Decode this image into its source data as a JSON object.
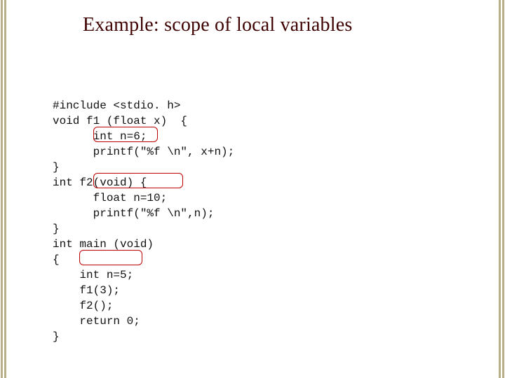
{
  "title": "Example: scope of local variables",
  "code": {
    "l01": "#include <stdio. h>",
    "l02": "void f1 (float x)  {",
    "l03": "      int n=6;",
    "l04": "      printf(\"%f \\n\", x+n);",
    "l05": "}",
    "l06": "int f2(void) {",
    "l07": "      float n=10;",
    "l08": "      printf(\"%f \\n\",n);",
    "l09": "}",
    "l10": "int main (void)",
    "l11": "{",
    "l12": "    int n=5;",
    "l13": "    f1(3);",
    "l14": "    f2();",
    "l15": "    return 0;",
    "l16": "}"
  },
  "highlights": {
    "h1": "int n=6;",
    "h2": "float n=10;",
    "h3": "int n=5;"
  }
}
